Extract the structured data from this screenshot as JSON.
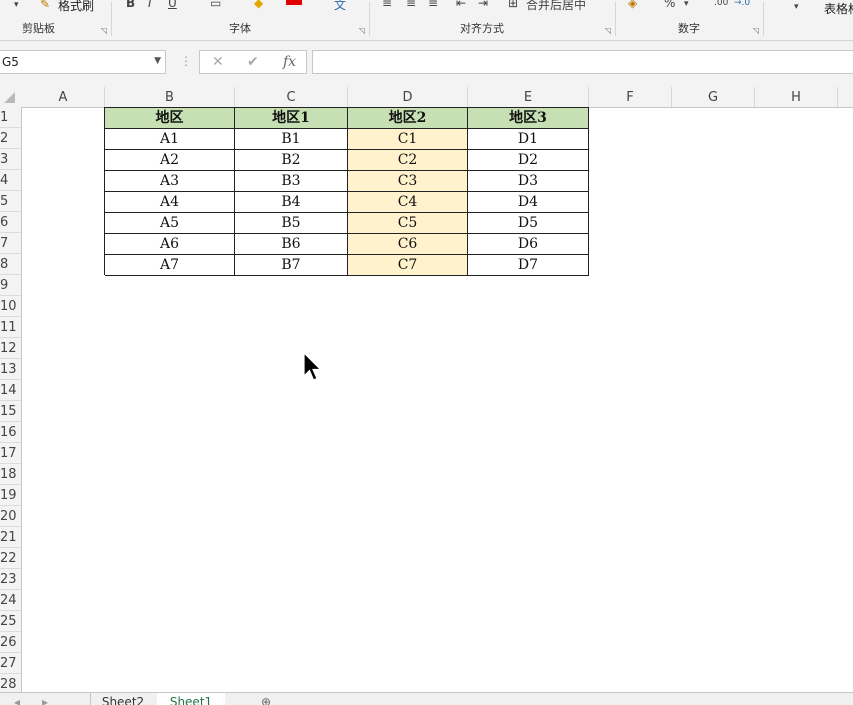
{
  "ribbon": {
    "format_painter": "格式刷",
    "groups": {
      "clipboard": "剪贴板",
      "font": "字体",
      "alignment": "对齐方式",
      "number": "数字",
      "styles": "表格格"
    },
    "merge_label": "合并后居中",
    "percent": "%"
  },
  "formula_bar": {
    "name_box": "G5",
    "cancel": "✕",
    "enter": "✔",
    "fx": "fx",
    "value": ""
  },
  "columns": [
    "A",
    "B",
    "C",
    "D",
    "E",
    "F",
    "G",
    "H"
  ],
  "rows": [
    "1",
    "2",
    "3",
    "4",
    "5",
    "6",
    "7",
    "8",
    "9",
    "10",
    "11",
    "12",
    "13",
    "14",
    "15",
    "16",
    "17",
    "18",
    "19",
    "20",
    "21",
    "22",
    "23",
    "24",
    "25",
    "26",
    "27",
    "28"
  ],
  "table": {
    "headers": [
      "地区",
      "地区1",
      "地区2",
      "地区3"
    ],
    "rows": [
      [
        "A1",
        "B1",
        "C1",
        "D1"
      ],
      [
        "A2",
        "B2",
        "C2",
        "D2"
      ],
      [
        "A3",
        "B3",
        "C3",
        "D3"
      ],
      [
        "A4",
        "B4",
        "C4",
        "D4"
      ],
      [
        "A5",
        "B5",
        "C5",
        "D5"
      ],
      [
        "A6",
        "B6",
        "C6",
        "D6"
      ],
      [
        "A7",
        "B7",
        "C7",
        "D7"
      ]
    ]
  },
  "sheets": [
    "Sheet2",
    "Sheet1"
  ],
  "colors": {
    "header_fill": "#c6e0b4",
    "highlight_fill": "#fff2cc",
    "active_tab": "#217346"
  }
}
